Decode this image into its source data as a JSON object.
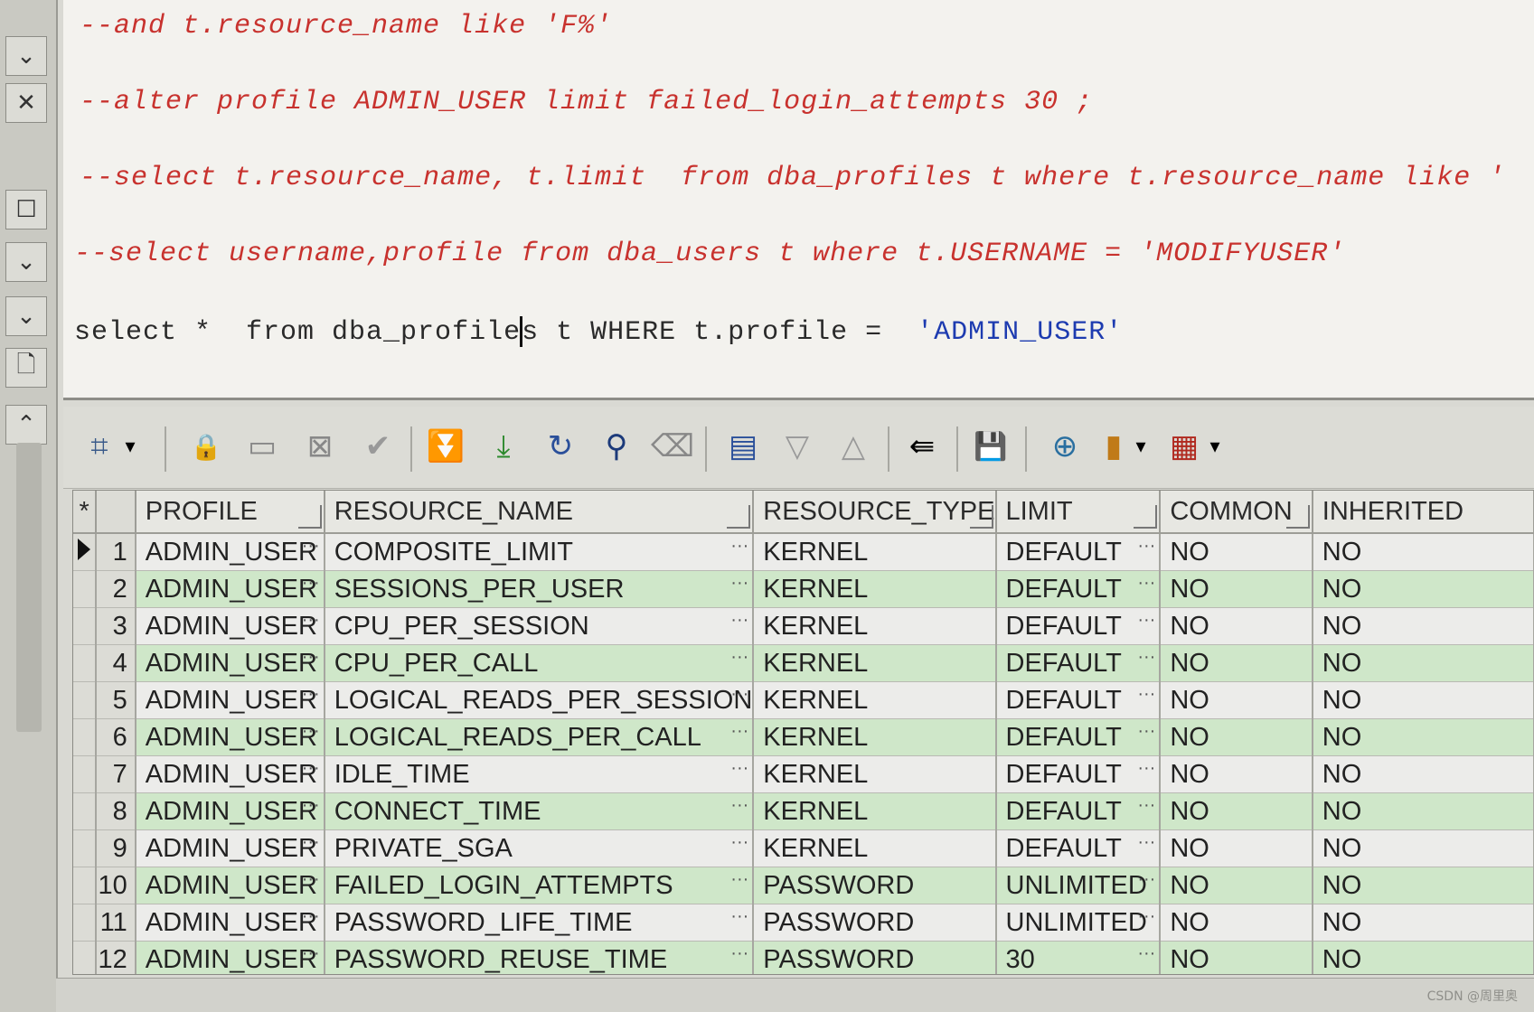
{
  "editor": {
    "lines": [
      "--and t.resource_name like 'F%'",
      "--alter profile ADMIN_USER limit failed_login_attempts 30 ;",
      "--select t.resource_name, t.limit  from dba_profiles t where t.resource_name like '",
      "--select username,profile from dba_users t where t.USERNAME = 'MODIFYUSER'"
    ],
    "query_prefix": "select *  from dba_profile",
    "query_cursor_char": "s",
    "query_middle": " t WHERE t.profile =  ",
    "query_string": "'ADMIN_USER'"
  },
  "toolbar": {
    "icons": [
      {
        "name": "grid-select-icon",
        "glyph": "⌗",
        "color": "#3a5a8a"
      },
      {
        "name": "dropdown-arrow-icon",
        "glyph": "▾",
        "color": "#333333"
      },
      {
        "name": "lock-icon",
        "glyph": "🔒",
        "color": "#8a1a1a"
      },
      {
        "name": "insert-record-icon",
        "glyph": "▭",
        "color": "#888888"
      },
      {
        "name": "delete-record-icon",
        "glyph": "⊠",
        "color": "#888888"
      },
      {
        "name": "post-changes-icon",
        "glyph": "✔",
        "color": "#999999"
      },
      {
        "name": "fetch-next-icon",
        "glyph": "⏬",
        "color": "#2d8a2d"
      },
      {
        "name": "fetch-last-icon",
        "glyph": "⤓",
        "color": "#2d8a2d"
      },
      {
        "name": "refresh-icon",
        "glyph": "↻",
        "color": "#2a4f9a"
      },
      {
        "name": "find-icon",
        "glyph": "⚲",
        "color": "#1c3a7a"
      },
      {
        "name": "clear-icon",
        "glyph": "⌫",
        "color": "#888888"
      },
      {
        "name": "single-record-view-icon",
        "glyph": "▤",
        "color": "#2a4f9a"
      },
      {
        "name": "next-record-icon",
        "glyph": "▽",
        "color": "#999999"
      },
      {
        "name": "previous-record-icon",
        "glyph": "△",
        "color": "#999999"
      },
      {
        "name": "export-icon",
        "glyph": "⇚",
        "color": "#333333"
      },
      {
        "name": "save-icon",
        "glyph": "💾",
        "color": "#1c3a7a"
      },
      {
        "name": "connect-icon",
        "glyph": "⊕",
        "color": "#2a6fa0"
      },
      {
        "name": "chart-icon",
        "glyph": "▮",
        "color": "#c07a18"
      },
      {
        "name": "chart-dropdown-icon",
        "glyph": "▾",
        "color": "#333333"
      },
      {
        "name": "table-view-icon",
        "glyph": "▦",
        "color": "#b0281e"
      },
      {
        "name": "table-view-dropdown-icon",
        "glyph": "▾",
        "color": "#333333"
      }
    ]
  },
  "grid": {
    "columns": [
      "PROFILE",
      "RESOURCE_NAME",
      "RESOURCE_TYPE",
      "LIMIT",
      "COMMON",
      "INHERITED"
    ],
    "indicator_header": "*",
    "rows": [
      {
        "n": "1",
        "profile": "ADMIN_USER",
        "resource_name": "COMPOSITE_LIMIT",
        "resource_type": "KERNEL",
        "limit": "DEFAULT",
        "common": "NO",
        "inherited": "NO"
      },
      {
        "n": "2",
        "profile": "ADMIN_USER",
        "resource_name": "SESSIONS_PER_USER",
        "resource_type": "KERNEL",
        "limit": "DEFAULT",
        "common": "NO",
        "inherited": "NO"
      },
      {
        "n": "3",
        "profile": "ADMIN_USER",
        "resource_name": "CPU_PER_SESSION",
        "resource_type": "KERNEL",
        "limit": "DEFAULT",
        "common": "NO",
        "inherited": "NO"
      },
      {
        "n": "4",
        "profile": "ADMIN_USER",
        "resource_name": "CPU_PER_CALL",
        "resource_type": "KERNEL",
        "limit": "DEFAULT",
        "common": "NO",
        "inherited": "NO"
      },
      {
        "n": "5",
        "profile": "ADMIN_USER",
        "resource_name": "LOGICAL_READS_PER_SESSION",
        "resource_type": "KERNEL",
        "limit": "DEFAULT",
        "common": "NO",
        "inherited": "NO"
      },
      {
        "n": "6",
        "profile": "ADMIN_USER",
        "resource_name": "LOGICAL_READS_PER_CALL",
        "resource_type": "KERNEL",
        "limit": "DEFAULT",
        "common": "NO",
        "inherited": "NO"
      },
      {
        "n": "7",
        "profile": "ADMIN_USER",
        "resource_name": "IDLE_TIME",
        "resource_type": "KERNEL",
        "limit": "DEFAULT",
        "common": "NO",
        "inherited": "NO"
      },
      {
        "n": "8",
        "profile": "ADMIN_USER",
        "resource_name": "CONNECT_TIME",
        "resource_type": "KERNEL",
        "limit": "DEFAULT",
        "common": "NO",
        "inherited": "NO"
      },
      {
        "n": "9",
        "profile": "ADMIN_USER",
        "resource_name": "PRIVATE_SGA",
        "resource_type": "KERNEL",
        "limit": "DEFAULT",
        "common": "NO",
        "inherited": "NO"
      },
      {
        "n": "10",
        "profile": "ADMIN_USER",
        "resource_name": "FAILED_LOGIN_ATTEMPTS",
        "resource_type": "PASSWORD",
        "limit": "UNLIMITED",
        "common": "NO",
        "inherited": "NO"
      },
      {
        "n": "11",
        "profile": "ADMIN_USER",
        "resource_name": "PASSWORD_LIFE_TIME",
        "resource_type": "PASSWORD",
        "limit": "UNLIMITED",
        "common": "NO",
        "inherited": "NO"
      },
      {
        "n": "12",
        "profile": "ADMIN_USER",
        "resource_name": "PASSWORD_REUSE_TIME",
        "resource_type": "PASSWORD",
        "limit": "30",
        "common": "NO",
        "inherited": "NO"
      }
    ],
    "ellipsis": "···"
  },
  "left_strip": {
    "icons": [
      {
        "name": "chevron-down-icon",
        "glyph": "⌄"
      },
      {
        "name": "close-icon",
        "glyph": "✕"
      },
      {
        "name": "checkbox-icon",
        "glyph": "☐"
      },
      {
        "name": "chevron-down-icon",
        "glyph": "⌄"
      },
      {
        "name": "chevron-down-icon",
        "glyph": "⌄"
      },
      {
        "name": "new-document-icon",
        "glyph": "🗋"
      },
      {
        "name": "chevron-up-icon",
        "glyph": "⌃"
      }
    ]
  },
  "watermark": "CSDN @周里奥",
  "colors": {
    "comment": "#c8322e",
    "string": "#1d3bb0",
    "row_even": "#cfe7c9",
    "row_odd": "#ececea"
  }
}
